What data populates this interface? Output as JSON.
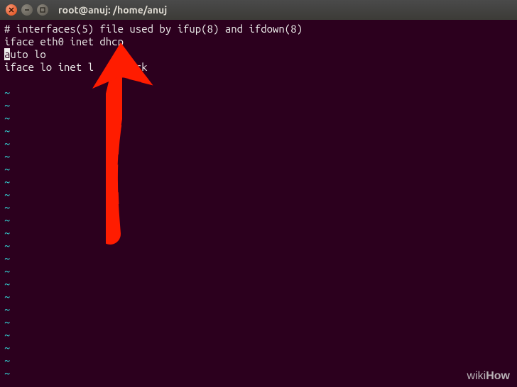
{
  "window": {
    "title": "root@anuj: /home/anuj"
  },
  "terminal": {
    "line1": "# interfaces(5) file used by ifup(8) and ifdown(8)",
    "line2": "iface eth0 inet dhcp",
    "line3_cursor": "a",
    "line3_rest": "uto lo",
    "line4_before": "iface lo inet l",
    "line4_after": "ck",
    "tilde": "~"
  },
  "annotation": {
    "arrow_color": "#ff1a00"
  },
  "watermark": {
    "part1": "wiki",
    "part2": "How"
  }
}
